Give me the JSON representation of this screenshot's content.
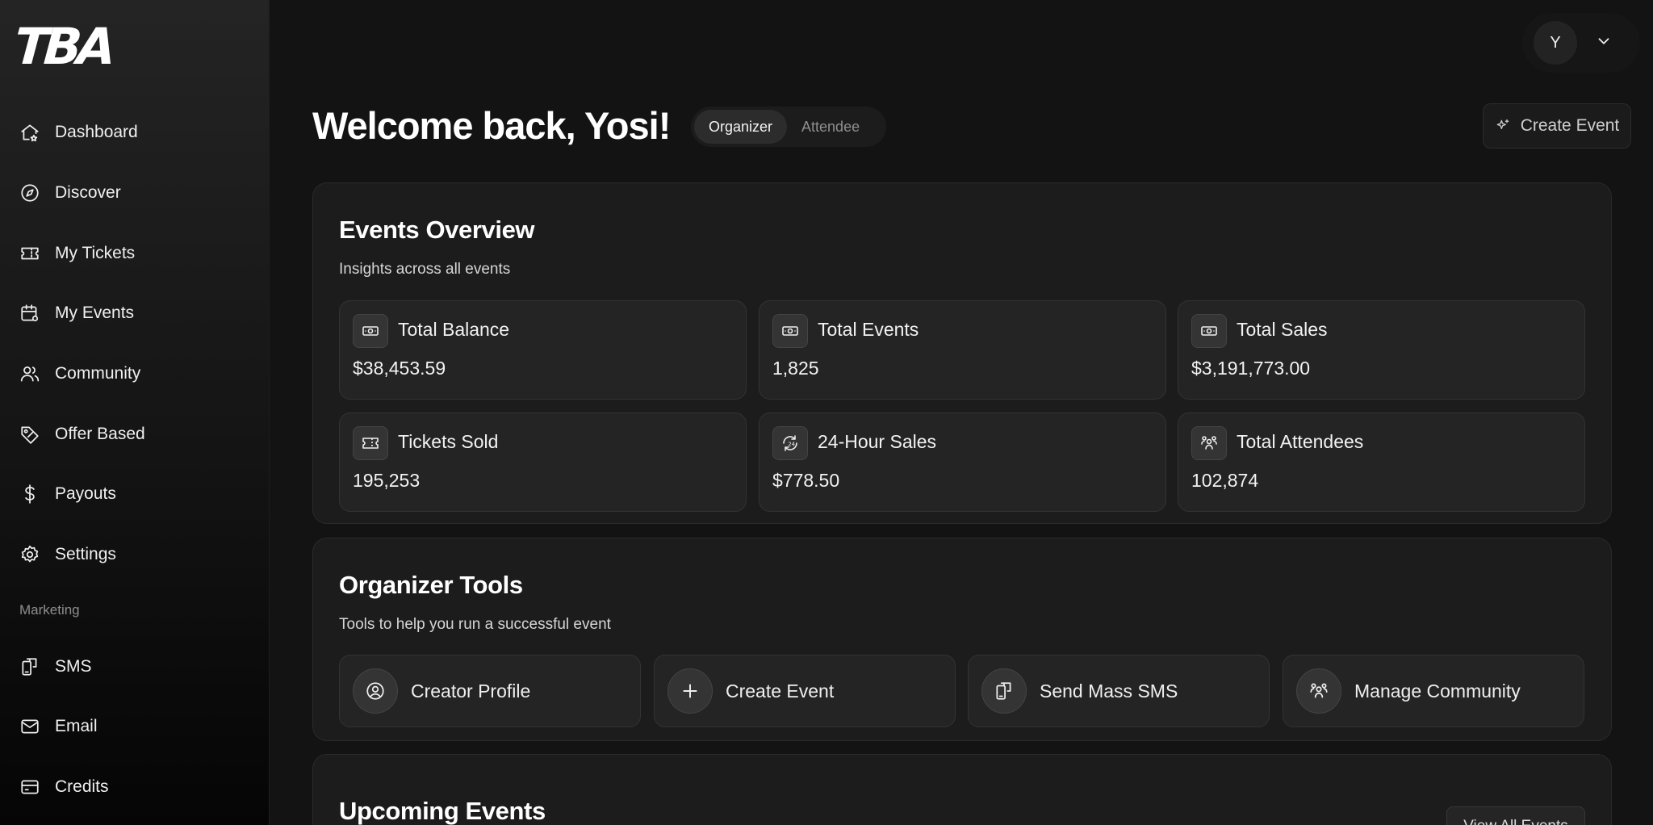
{
  "brand": {
    "logo_text": "TBA"
  },
  "sidebar": {
    "items": [
      {
        "label": "Dashboard",
        "icon": "home-icon"
      },
      {
        "label": "Discover",
        "icon": "compass-icon"
      },
      {
        "label": "My Tickets",
        "icon": "ticket-icon"
      },
      {
        "label": "My Events",
        "icon": "calendar-icon"
      },
      {
        "label": "Community",
        "icon": "users-icon"
      },
      {
        "label": "Offer Based",
        "icon": "tag-icon"
      },
      {
        "label": "Payouts",
        "icon": "dollar-icon"
      },
      {
        "label": "Settings",
        "icon": "gear-icon"
      }
    ],
    "section_label": "Marketing",
    "marketing_items": [
      {
        "label": "SMS",
        "icon": "sms-icon"
      },
      {
        "label": "Email",
        "icon": "mail-icon"
      },
      {
        "label": "Credits",
        "icon": "credit-card-icon"
      }
    ]
  },
  "header": {
    "welcome": "Welcome back, Yosi!",
    "toggle": {
      "options": [
        "Organizer",
        "Attendee"
      ],
      "selected": "Organizer"
    },
    "create_event_label": "Create Event",
    "avatar_initial": "Y"
  },
  "overview": {
    "title": "Events Overview",
    "subtitle": "Insights across all events",
    "stats": [
      {
        "label": "Total Balance",
        "value": "$38,453.59",
        "icon": "cash-icon"
      },
      {
        "label": "Total Events",
        "value": "1,825",
        "icon": "cash-icon"
      },
      {
        "label": "Total Sales",
        "value": "$3,191,773.00",
        "icon": "cash-icon"
      },
      {
        "label": "Tickets Sold",
        "value": "195,253",
        "icon": "ticket-icon"
      },
      {
        "label": "24-Hour Sales",
        "value": "$778.50",
        "icon": "clock-24-icon"
      },
      {
        "label": "Total Attendees",
        "value": "102,874",
        "icon": "users-group-icon"
      }
    ]
  },
  "tools": {
    "title": "Organizer Tools",
    "subtitle": "Tools to help you run a successful event",
    "items": [
      {
        "label": "Creator Profile",
        "icon": "user-circle-icon"
      },
      {
        "label": "Create Event",
        "icon": "plus-icon"
      },
      {
        "label": "Send Mass SMS",
        "icon": "sms-icon"
      },
      {
        "label": "Manage Community",
        "icon": "users-group-icon"
      }
    ]
  },
  "upcoming": {
    "title": "Upcoming Events",
    "view_all_label": "View All Events"
  }
}
